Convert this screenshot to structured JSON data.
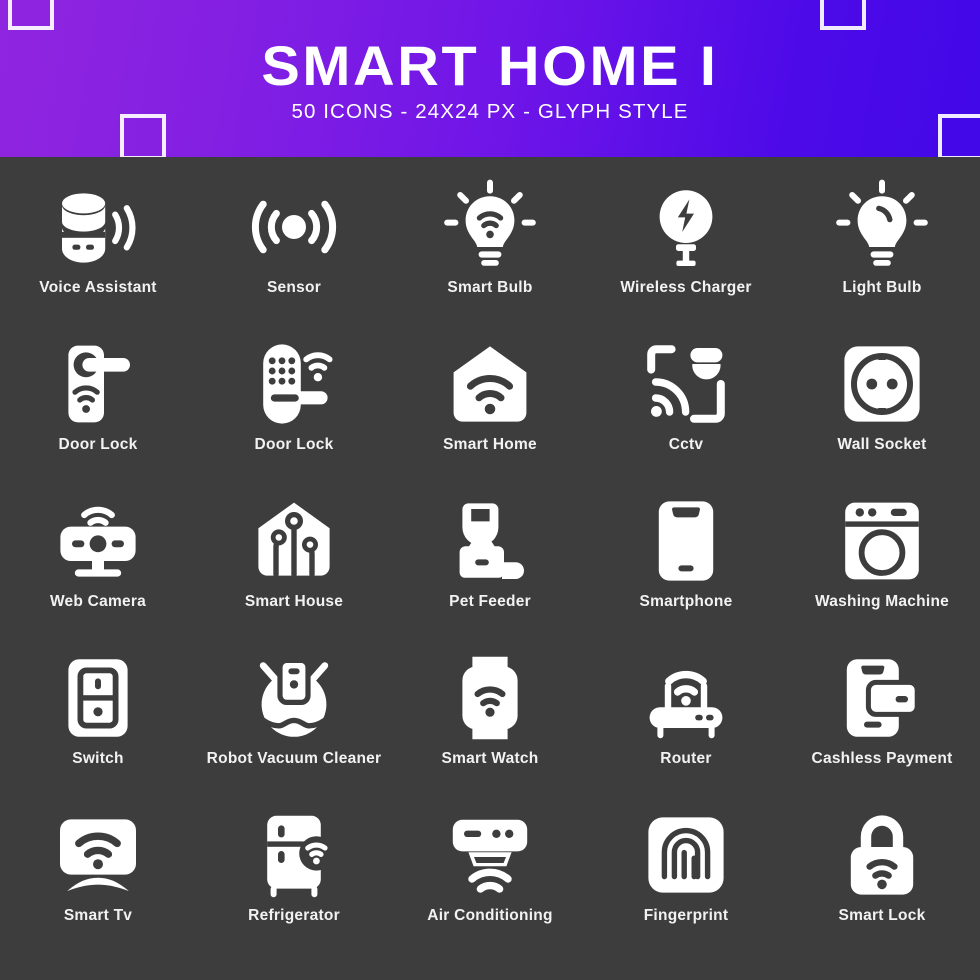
{
  "header": {
    "title": "SMART HOME I",
    "subtitle": "50 ICONS - 24X24 PX - GLYPH STYLE",
    "gradient_start": "#9025e0",
    "gradient_end": "#4208e8",
    "decor_square_color": "#ffffff",
    "decor_square_count": 4
  },
  "theme": {
    "background": "#3d3d3d",
    "icon_color": "#ffffff",
    "label_color": "#f2f2f2"
  },
  "grid": {
    "columns": 5,
    "rows": 5,
    "visible_icon_count": 25
  },
  "icons": [
    {
      "id": "voice-assistant",
      "label": "Voice Assistant",
      "icon": "voice-assistant-icon"
    },
    {
      "id": "sensor",
      "label": "Sensor",
      "icon": "sensor-icon"
    },
    {
      "id": "smart-bulb",
      "label": "Smart Bulb",
      "icon": "smart-bulb-icon"
    },
    {
      "id": "wireless-charger",
      "label": "Wireless Charger",
      "icon": "wireless-charger-icon"
    },
    {
      "id": "light-bulb",
      "label": "Light Bulb",
      "icon": "light-bulb-icon"
    },
    {
      "id": "door-lock-handle",
      "label": "Door Lock",
      "icon": "door-lock-handle-icon"
    },
    {
      "id": "door-lock-keypad",
      "label": "Door Lock",
      "icon": "door-lock-keypad-icon"
    },
    {
      "id": "smart-home",
      "label": "Smart Home",
      "icon": "smart-home-icon"
    },
    {
      "id": "cctv",
      "label": "Cctv",
      "icon": "cctv-icon"
    },
    {
      "id": "wall-socket",
      "label": "Wall Socket",
      "icon": "wall-socket-icon"
    },
    {
      "id": "web-camera",
      "label": "Web Camera",
      "icon": "web-camera-icon"
    },
    {
      "id": "smart-house",
      "label": "Smart House",
      "icon": "smart-house-icon"
    },
    {
      "id": "pet-feeder",
      "label": "Pet Feeder",
      "icon": "pet-feeder-icon"
    },
    {
      "id": "smartphone",
      "label": "Smartphone",
      "icon": "smartphone-icon"
    },
    {
      "id": "washing-machine",
      "label": "Washing Machine",
      "icon": "washing-machine-icon"
    },
    {
      "id": "switch",
      "label": "Switch",
      "icon": "switch-icon"
    },
    {
      "id": "robot-vacuum-cleaner",
      "label": "Robot Vacuum Cleaner",
      "icon": "robot-vacuum-cleaner-icon"
    },
    {
      "id": "smart-watch",
      "label": "Smart Watch",
      "icon": "smart-watch-icon"
    },
    {
      "id": "router",
      "label": "Router",
      "icon": "router-icon"
    },
    {
      "id": "cashless-payment",
      "label": "Cashless Payment",
      "icon": "cashless-payment-icon"
    },
    {
      "id": "smart-tv",
      "label": "Smart Tv",
      "icon": "smart-tv-icon"
    },
    {
      "id": "refrigerator",
      "label": "Refrigerator",
      "icon": "refrigerator-icon"
    },
    {
      "id": "air-conditioning",
      "label": "Air Conditioning",
      "icon": "air-conditioning-icon"
    },
    {
      "id": "fingerprint",
      "label": "Fingerprint",
      "icon": "fingerprint-icon"
    },
    {
      "id": "smart-lock",
      "label": "Smart Lock",
      "icon": "smart-lock-icon"
    }
  ]
}
